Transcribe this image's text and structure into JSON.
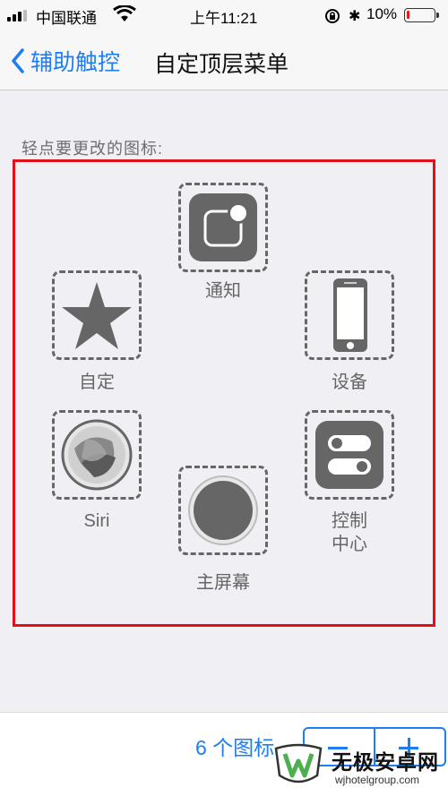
{
  "status_bar": {
    "carrier": "中国联通",
    "time": "上午11:21",
    "battery_percent": "10%",
    "battery_level": 0.1,
    "battery_color": "#e02020"
  },
  "nav": {
    "back_label": "辅助触控",
    "title": "自定顶层菜单",
    "accent_color": "#1d7ef3"
  },
  "section_label": "轻点要更改的图标:",
  "highlight_color": "#e3101a",
  "menu_items": [
    {
      "label": "通知",
      "icon": "notification-icon"
    },
    {
      "label": "自定",
      "icon": "star-icon"
    },
    {
      "label": "设备",
      "icon": "iphone-device-icon"
    },
    {
      "label": "Siri",
      "icon": "siri-icon"
    },
    {
      "label": "控制",
      "label2": "中心",
      "icon": "control-center-icon"
    },
    {
      "label": "主屏幕",
      "icon": "home-button-icon"
    }
  ],
  "bottom": {
    "icon_count_label": "6 个图标",
    "decrement_icon": "minus-icon",
    "increment_icon": "plus-icon"
  },
  "watermark": {
    "title": "无极安卓网",
    "url": "wjhotelgroup.com"
  }
}
